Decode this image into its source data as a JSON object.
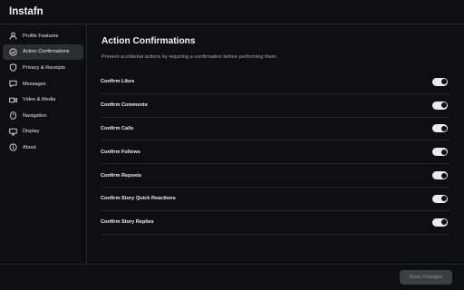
{
  "app": {
    "title": "Instafn"
  },
  "sidebar": {
    "items": [
      {
        "label": "Profile Features",
        "icon": "user-icon",
        "active": false
      },
      {
        "label": "Action Confirmations",
        "icon": "check-circle-icon",
        "active": true
      },
      {
        "label": "Privacy & Receipts",
        "icon": "shield-icon",
        "active": false
      },
      {
        "label": "Messages",
        "icon": "message-icon",
        "active": false
      },
      {
        "label": "Video & Media",
        "icon": "video-icon",
        "active": false
      },
      {
        "label": "Navigation",
        "icon": "compass-icon",
        "active": false
      },
      {
        "label": "Display",
        "icon": "monitor-icon",
        "active": false
      },
      {
        "label": "About",
        "icon": "info-icon",
        "active": false
      }
    ]
  },
  "main": {
    "title": "Action Confirmations",
    "description": "Prevent accidental actions by requiring a confirmation before performing them.",
    "settings": [
      {
        "label": "Confirm Likes",
        "enabled": true
      },
      {
        "label": "Confirm Comments",
        "enabled": true
      },
      {
        "label": "Confirm Calls",
        "enabled": true
      },
      {
        "label": "Confirm Follows",
        "enabled": true
      },
      {
        "label": "Confirm Reposts",
        "enabled": true
      },
      {
        "label": "Confirm Story Quick Reactions",
        "enabled": true
      },
      {
        "label": "Confirm Story Replies",
        "enabled": true
      }
    ]
  },
  "footer": {
    "save_label": "Save Changes",
    "save_enabled": false
  },
  "colors": {
    "background": "#0d1012",
    "active_item": "#2a2f33",
    "toggle_on": "#e9ebec",
    "divider": "#23282c"
  }
}
